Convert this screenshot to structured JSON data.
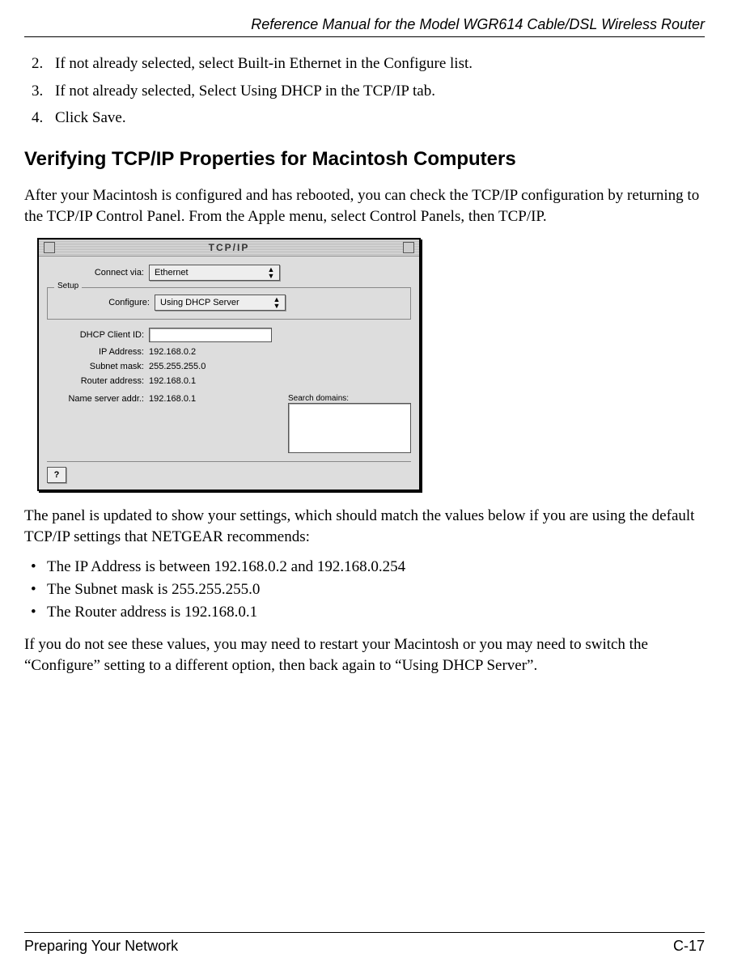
{
  "doc_title": "Reference Manual for the Model WGR614 Cable/DSL Wireless Router",
  "steps_start": 2,
  "steps": [
    "If not already selected, select Built-in Ethernet in the Configure list.",
    "If not already selected, Select Using DHCP in the TCP/IP tab.",
    "Click Save."
  ],
  "section_heading": "Verifying TCP/IP Properties for Macintosh Computers",
  "intro_paragraph": "After your Macintosh is configured and has rebooted, you can check the TCP/IP configuration by returning to the TCP/IP Control Panel. From the Apple menu, select Control Panels, then TCP/IP.",
  "panel": {
    "window_title": "TCP/IP",
    "connect_via_label": "Connect via:",
    "connect_via_value": "Ethernet",
    "setup_legend": "Setup",
    "configure_label": "Configure:",
    "configure_value": "Using DHCP Server",
    "dhcp_client_id_label": "DHCP Client ID:",
    "dhcp_client_id_value": "",
    "ip_address_label": "IP Address:",
    "ip_address_value": "192.168.0.2",
    "subnet_mask_label": "Subnet mask:",
    "subnet_mask_value": "255.255.255.0",
    "router_address_label": "Router address:",
    "router_address_value": "192.168.0.1",
    "name_server_label": "Name server addr.:",
    "name_server_value": "192.168.0.1",
    "search_domains_label": "Search domains:",
    "help_button": "?"
  },
  "after_panel_paragraph": "The panel is updated to show your settings, which should match the values below if you are using the default TCP/IP settings that NETGEAR recommends:",
  "bullets": [
    "The IP Address is between 192.168.0.2 and 192.168.0.254",
    "The Subnet mask is 255.255.255.0",
    "The Router address is 192.168.0.1"
  ],
  "closing_paragraph": "If you do not see these values, you may need to restart your Macintosh or you may need to switch the “Configure” setting to a different option, then back again to “Using DHCP Server”.",
  "footer_left": "Preparing Your Network",
  "footer_right": "C-17"
}
